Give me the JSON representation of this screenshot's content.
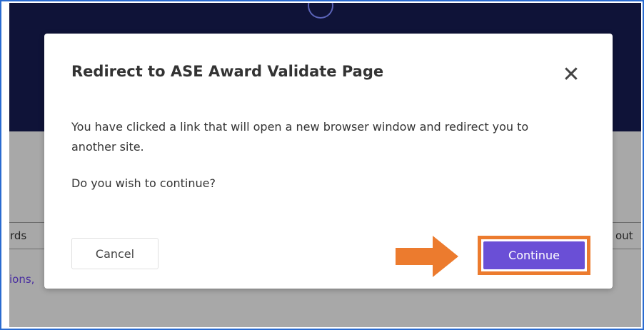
{
  "background_page": {
    "tab_left_label": "rds",
    "tab_right_label": "out",
    "link_text": "ions,"
  },
  "dialog": {
    "title": "Redirect to ASE Award Validate Page",
    "close_glyph": "✕",
    "message": "You have clicked a link that will open a new browser window and redirect you to another site.",
    "question": "Do you wish to continue?",
    "cancel_label": "Cancel",
    "continue_label": "Continue"
  },
  "colors": {
    "header_navy": "#0f1338",
    "overlay_gray": "#a8a8a8",
    "continue_purple": "#6a4fd6",
    "annotation_orange": "#ec7b2e",
    "frame_blue": "#2a6bd0"
  }
}
